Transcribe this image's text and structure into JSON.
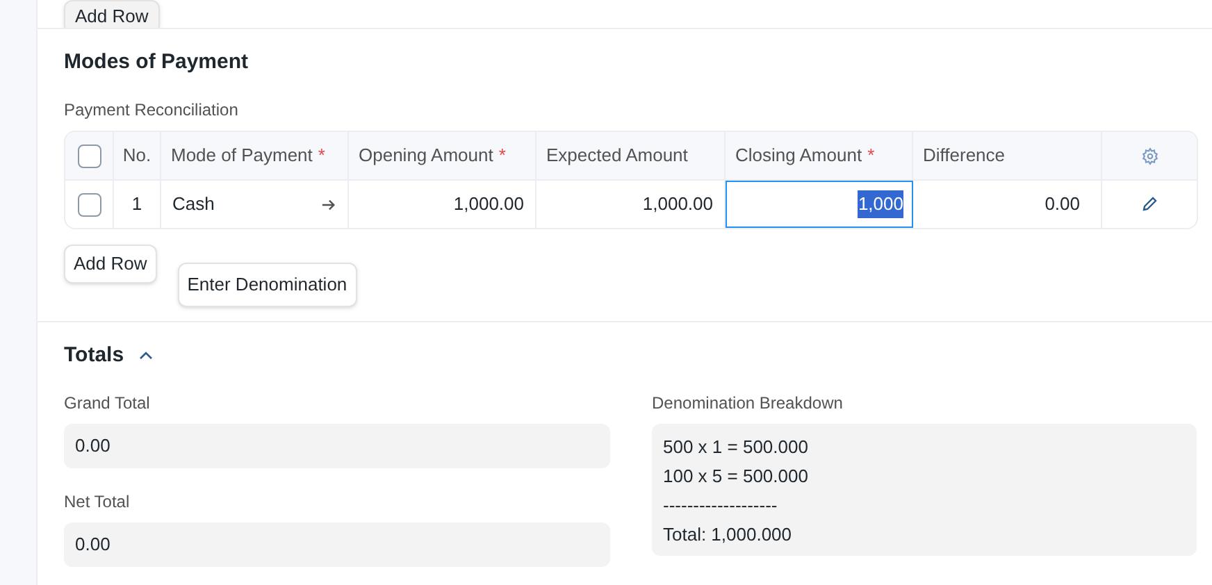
{
  "top_button": "Add Row",
  "section": {
    "title": "Modes of Payment",
    "table": {
      "label": "Payment Reconciliation",
      "select_all": {
        "checked": false
      },
      "columns": [
        {
          "label": "No."
        },
        {
          "label": "Mode of Payment",
          "required_mark": "*"
        },
        {
          "label": "Opening Amount",
          "required_mark": "*"
        },
        {
          "label": "Expected Amount"
        },
        {
          "label": "Closing Amount",
          "required_mark": "*"
        },
        {
          "label": "Difference"
        }
      ],
      "rows": [
        {
          "checked": false,
          "no": "1",
          "mode": "Cash",
          "opening": "1,000.00",
          "expected": "1,000.00",
          "closing": "1,000",
          "closing_focused": true,
          "difference": "0.00"
        }
      ]
    },
    "buttons": [
      "Add Row",
      "Enter Denomination"
    ]
  },
  "totals": {
    "title": "Totals",
    "expanded": true,
    "fields": [
      {
        "label": "Grand Total",
        "value": "0.00"
      },
      {
        "label": "Net Total",
        "value": "0.00"
      }
    ],
    "breakdown": {
      "label": "Denomination Breakdown",
      "lines": [
        "500 x 1 = 500.000",
        "100 x 5 = 500.000",
        "-------------------",
        "Total: 1,000.000"
      ]
    }
  }
}
